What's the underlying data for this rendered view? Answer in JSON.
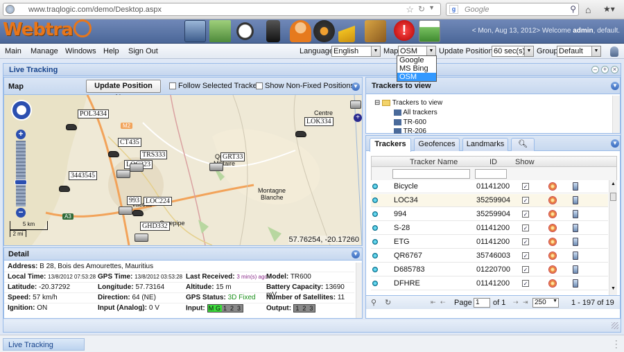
{
  "browser": {
    "url": "www.traqlogic.com/demo/Desktop.aspx",
    "search_placeholder": "Google"
  },
  "header": {
    "logo_text": "Webtra",
    "welcome_prefix": "< Mon, Aug 13, 2012> Welcome ",
    "user": "admin",
    "welcome_suffix": ", default."
  },
  "menu": {
    "items": [
      "Main",
      "Manage",
      "Windows",
      "Help",
      "Sign Out"
    ],
    "language_label": "Language",
    "language_value": "English",
    "map_label": "Map",
    "map_value": "OSM",
    "map_options": [
      "Google",
      "MS Bing",
      "OSM"
    ],
    "update_label": "Update Positions",
    "update_value": "60 sec(s)",
    "group_label": "Group",
    "group_value": "Default"
  },
  "live": {
    "title": "Live Tracking"
  },
  "map": {
    "title": "Map",
    "update_button": "Update Position Now",
    "follow_label": "Follow Selected Tracker",
    "nonfixed_label": "Show Non-Fixed Positions",
    "coordinates": "57.76254, -20.17260",
    "scale_km": "5 km",
    "scale_mi": "2 mi",
    "road_m2": "M2",
    "road_a3": "A3",
    "markers": [
      "POL3434",
      "CT435",
      "TRS333",
      "LOC223",
      "3443545",
      "LOC224",
      "993",
      "GHD332",
      "GRT33",
      "LOK334"
    ],
    "places": [
      "Centre",
      "Quartier",
      "Militaire",
      "Montagne",
      "Blanche",
      "Vacoas",
      "Curepipe"
    ]
  },
  "detail": {
    "title": "Detail",
    "address_label": "Address:",
    "address": "B 28, Bois des Amourettes, Mauritius",
    "local_time_label": "Local Time:",
    "local_time": "13/8/2012 07:53:28",
    "gps_time_label": "GPS Time:",
    "gps_time": "13/8/2012 03:53:28",
    "last_received_label": "Last Received:",
    "last_received": "3 min(s) ago",
    "model_label": "Model:",
    "model": "TR600",
    "latitude_label": "Latitude:",
    "latitude": "-20.37292",
    "longitude_label": "Longitude:",
    "longitude": "57.73164",
    "altitude_label": "Altitude:",
    "altitude": "15 m",
    "battery_label": "Battery Capacity:",
    "battery": "13690 mV",
    "speed_label": "Speed:",
    "speed": "57 km/h",
    "direction_label": "Direction:",
    "direction": "64 (NE)",
    "gps_status_label": "GPS Status:",
    "gps_status": "3D Fixed",
    "satellites_label": "Number of Satellites:",
    "satellites": "11",
    "ignition_label": "Ignition:",
    "ignition": "ON",
    "input_analog_label": "Input (Analog):",
    "input_analog": "0 V",
    "input_label": "Input:",
    "input_bits": [
      "M",
      "G",
      "1",
      "2",
      "3"
    ],
    "output_label": "Output:",
    "output_bits": [
      "1",
      "2",
      "3"
    ]
  },
  "trackers_tree": {
    "title": "Trackers to view",
    "root": "Trackers to view",
    "items": [
      "All trackers",
      "TR-600",
      "TR-206"
    ]
  },
  "grid": {
    "tabs": [
      "Trackers",
      "Geofences",
      "Landmarks"
    ],
    "columns": [
      "Tracker Name",
      "ID",
      "Show"
    ],
    "rows": [
      {
        "name": "Bicycle",
        "id": "01141200"
      },
      {
        "name": "LOC34",
        "id": "35259904"
      },
      {
        "name": "994",
        "id": "35259904"
      },
      {
        "name": "S-28",
        "id": "01141200"
      },
      {
        "name": "ETG",
        "id": "01141200"
      },
      {
        "name": "QR6767",
        "id": "35746003"
      },
      {
        "name": "D685783",
        "id": "01220700"
      },
      {
        "name": "DFHRE",
        "id": "01141200"
      }
    ],
    "page_label": "Page",
    "page": "1",
    "of_label": "of 1",
    "page_size": "250",
    "range": "1 - 197 of 19"
  },
  "taskbar": {
    "item": "Live Tracking"
  }
}
